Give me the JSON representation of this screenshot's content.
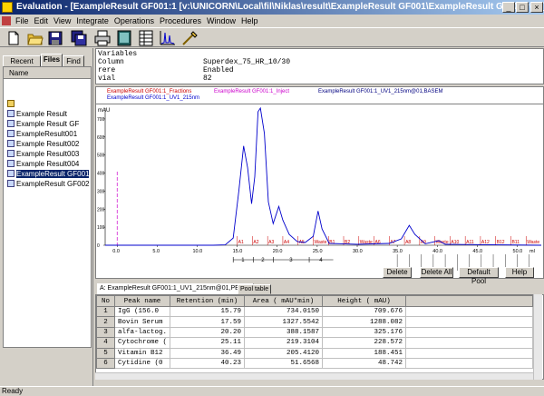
{
  "window": {
    "title": "Evaluation - [ExampleResult GF001:1   [v:\\UNICORN\\Local\\fil\\Niklas\\result\\ExampleResult GF001\\ExampleResult GF001.res]]",
    "min": "_",
    "max": "□",
    "close": "×"
  },
  "menu": [
    "File",
    "Edit",
    "View",
    "Integrate",
    "Operations",
    "Procedures",
    "Window",
    "Help"
  ],
  "toolbar": {
    "icons": [
      "new-icon",
      "open-icon",
      "save-icon",
      "print-icon",
      "report-icon",
      "peak-table-icon",
      "chromatogram-icon",
      "integrate-icon"
    ]
  },
  "left_panel": {
    "tabs": [
      "Recent Runs",
      "Files",
      "Find"
    ],
    "header": "Name",
    "items": [
      {
        "label": "",
        "icon": "folder-icon"
      },
      {
        "label": "Example Result",
        "icon": "result-icon"
      },
      {
        "label": "Example Result GF",
        "icon": "result-icon"
      },
      {
        "label": "ExampleResult001",
        "icon": "result-icon"
      },
      {
        "label": "Example Result002",
        "icon": "result-icon"
      },
      {
        "label": "Example Result003",
        "icon": "result-icon"
      },
      {
        "label": "Example Result004",
        "icon": "result-icon"
      },
      {
        "label": "ExampleResult GF001",
        "icon": "result-icon",
        "selected": true
      },
      {
        "label": "ExampleResult GF002",
        "icon": "result-icon"
      }
    ]
  },
  "variables": {
    "title": "Variables",
    "rows": [
      {
        "name": "Column",
        "value": "Superdex_75_HR_10/30"
      },
      {
        "name": "rere",
        "value": "Enabled"
      },
      {
        "name": "vial",
        "value": "82"
      }
    ]
  },
  "chart_legend": {
    "fractions": "ExampleResult GF001:1_Fractions",
    "inject": "ExampleResult GF001:1_Inject",
    "uv1_basem": "ExampleResult GF001:1_UV1_215nm@01,BASEM",
    "uv1": "ExampleResult GF001:1_UV1_215nm"
  },
  "chart_data": {
    "type": "line",
    "ylabel": "mAU",
    "yticks": [
      "700",
      "600",
      "500",
      "400",
      "300",
      "200",
      "100",
      "0"
    ],
    "xticks": [
      "0.0",
      "5.0",
      "10.0",
      "15.0",
      "20.0",
      "25.0",
      "30.0",
      "35.0",
      "40.0",
      "45.0",
      "50.0",
      "ml"
    ],
    "x_range": [
      -1.5,
      53
    ],
    "y_range": [
      0,
      760
    ],
    "series": [
      {
        "name": "ExampleResult GF001:1_UV1_215nm",
        "points": [
          [
            -1.5,
            0
          ],
          [
            12,
            0
          ],
          [
            13.5,
            2
          ],
          [
            14.5,
            40
          ],
          [
            15.2,
            300
          ],
          [
            15.8,
            550
          ],
          [
            16.3,
            430
          ],
          [
            16.8,
            230
          ],
          [
            17.2,
            380
          ],
          [
            17.6,
            740
          ],
          [
            17.9,
            760
          ],
          [
            18.4,
            620
          ],
          [
            18.9,
            240
          ],
          [
            19.5,
            120
          ],
          [
            20.2,
            215
          ],
          [
            20.7,
            140
          ],
          [
            21.5,
            60
          ],
          [
            22.5,
            20
          ],
          [
            23.5,
            15
          ],
          [
            24.5,
            50
          ],
          [
            25.1,
            190
          ],
          [
            25.6,
            90
          ],
          [
            26.5,
            10
          ],
          [
            30,
            5
          ],
          [
            34,
            10
          ],
          [
            35.5,
            35
          ],
          [
            36.5,
            110
          ],
          [
            37.2,
            60
          ],
          [
            38.5,
            8
          ],
          [
            40.2,
            25
          ],
          [
            41,
            5
          ],
          [
            53,
            0
          ]
        ]
      }
    ],
    "injection_x": 0,
    "fractions": {
      "labels": [
        "A1",
        "A2",
        "A3",
        "A4",
        "A5",
        "Waste",
        "B1",
        "B2",
        "Waste",
        "A6",
        "A7",
        "A8",
        "A9",
        "Waste",
        "A10",
        "A11",
        "A12",
        "B12",
        "B11",
        "Waste"
      ]
    },
    "peak_markers": [
      "1",
      "2",
      "3",
      "4"
    ]
  },
  "buttons": [
    "Delete",
    "Delete All",
    "Default Pool",
    "Help"
  ],
  "table_tabs": [
    "A: ExampleResult GF001:1_UV1_215nm@01,PEAK1",
    "Pool table"
  ],
  "peak_table": {
    "headers": [
      "No",
      "Peak name",
      "Retention (min)",
      "Area ( mAU*min)",
      "Height ( mAU)"
    ],
    "rows": [
      [
        "1",
        "IgG (156.0",
        "15.79",
        "734.0150",
        "709.676"
      ],
      [
        "2",
        "Bovin Serum",
        "17.59",
        "1327.5542",
        "1288.082"
      ],
      [
        "3",
        "alfa-lactog.",
        "20.20",
        "388.1587",
        "325.176"
      ],
      [
        "4",
        "Cytochrome (",
        "25.11",
        "219.3104",
        "228.572"
      ],
      [
        "5",
        "Vitamin B12",
        "36.49",
        "205.4120",
        "188.451"
      ],
      [
        "6",
        "Cytidine (0",
        "40.23",
        "51.6568",
        "48.742"
      ]
    ]
  },
  "status": "Ready",
  "colors": {
    "uv": "#0000cc",
    "fractions": "#cc0000",
    "inject": "#cc00cc",
    "title_bar": "#0a246a"
  }
}
